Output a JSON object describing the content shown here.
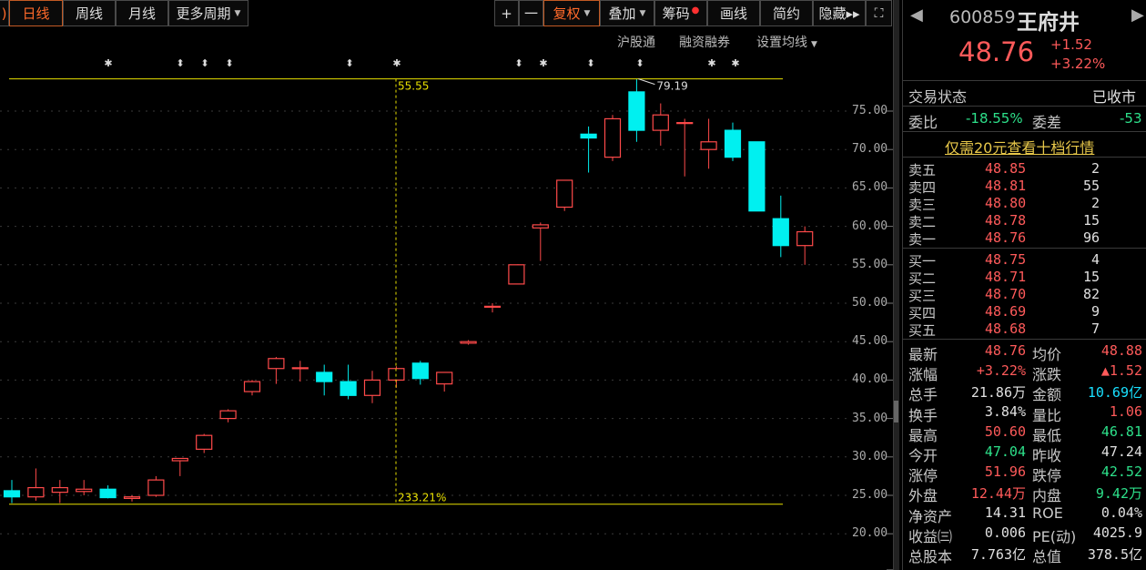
{
  "toolbar": {
    "periods": [
      "日线",
      "周线",
      "月线",
      "更多周期"
    ],
    "tools": [
      "+",
      "一",
      "复权",
      "叠加",
      "筹码",
      "画线",
      "简约",
      "隐藏▸▸"
    ]
  },
  "subbar": {
    "hgt": "沪股通",
    "margin": "融资融券",
    "ma_setting": "设置均线"
  },
  "chart_data": {
    "type": "candlestick",
    "y_ticks": [
      "75.00",
      "70.00",
      "65.00",
      "60.00",
      "55.00",
      "50.00",
      "45.00",
      "40.00",
      "35.00",
      "30.00",
      "25.00",
      "20.00"
    ],
    "ylim": [
      15,
      85
    ],
    "annotations": {
      "high_label": "79.19",
      "top_line": "55.55",
      "bottom_pct": "233.21%"
    },
    "candles": [
      {
        "o": 25.6,
        "h": 27.0,
        "l": 24.0,
        "c": 24.8
      },
      {
        "o": 24.8,
        "h": 28.5,
        "l": 24.3,
        "c": 26.0
      },
      {
        "o": 25.4,
        "h": 27.0,
        "l": 24.0,
        "c": 26.0
      },
      {
        "o": 25.5,
        "h": 27.0,
        "l": 25.0,
        "c": 25.8
      },
      {
        "o": 25.8,
        "h": 26.3,
        "l": 24.6,
        "c": 24.7
      },
      {
        "o": 24.6,
        "h": 25.0,
        "l": 24.2,
        "c": 24.8
      },
      {
        "o": 25.0,
        "h": 27.5,
        "l": 24.8,
        "c": 27.0
      },
      {
        "o": 29.5,
        "h": 29.8,
        "l": 27.5,
        "c": 29.8
      },
      {
        "o": 31.0,
        "h": 33.0,
        "l": 30.5,
        "c": 32.8
      },
      {
        "o": 35.0,
        "h": 36.2,
        "l": 34.5,
        "c": 36.0
      },
      {
        "o": 38.5,
        "h": 40.0,
        "l": 38.0,
        "c": 39.8
      },
      {
        "o": 41.5,
        "h": 43.0,
        "l": 39.5,
        "c": 42.8
      },
      {
        "o": 41.6,
        "h": 42.5,
        "l": 39.8,
        "c": 41.6
      },
      {
        "o": 41.0,
        "h": 42.0,
        "l": 38.0,
        "c": 39.8
      },
      {
        "o": 39.8,
        "h": 42.0,
        "l": 37.5,
        "c": 38.0
      },
      {
        "o": 38.0,
        "h": 41.2,
        "l": 37.0,
        "c": 40.0
      },
      {
        "o": 40.0,
        "h": 41.8,
        "l": 39.0,
        "c": 41.5
      },
      {
        "o": 42.2,
        "h": 42.5,
        "l": 39.4,
        "c": 40.2
      },
      {
        "o": 39.5,
        "h": 41.0,
        "l": 38.5,
        "c": 41.0
      },
      {
        "o": 44.8,
        "h": 45.2,
        "l": 44.6,
        "c": 45.0
      },
      {
        "o": 49.5,
        "h": 50.0,
        "l": 48.8,
        "c": 49.6
      },
      {
        "o": 52.5,
        "h": 55.0,
        "l": 52.5,
        "c": 55.0
      },
      {
        "o": 59.8,
        "h": 60.5,
        "l": 55.5,
        "c": 60.2
      },
      {
        "o": 62.5,
        "h": 66.0,
        "l": 62.0,
        "c": 66.0
      },
      {
        "o": 72.0,
        "h": 73.0,
        "l": 67.0,
        "c": 71.5
      },
      {
        "o": 69.0,
        "h": 74.5,
        "l": 68.5,
        "c": 74.0
      },
      {
        "o": 77.5,
        "h": 79.19,
        "l": 71.0,
        "c": 72.5
      },
      {
        "o": 72.5,
        "h": 76.0,
        "l": 70.5,
        "c": 74.5
      },
      {
        "o": 73.5,
        "h": 74.0,
        "l": 66.5,
        "c": 73.5
      },
      {
        "o": 70.0,
        "h": 74.0,
        "l": 67.5,
        "c": 71.0
      },
      {
        "o": 72.5,
        "h": 73.5,
        "l": 68.5,
        "c": 69.0
      },
      {
        "o": 71.0,
        "h": 71.0,
        "l": 62.0,
        "c": 62.0
      },
      {
        "o": 61.0,
        "h": 64.0,
        "l": 56.0,
        "c": 57.5
      },
      {
        "o": 57.5,
        "h": 60.0,
        "l": 55.0,
        "c": 59.3
      }
    ]
  },
  "quote": {
    "code": "600859",
    "name": "王府井",
    "price": "48.76",
    "change": "+1.52",
    "pct": "+3.22%",
    "status_label": "交易状态",
    "status": "已收市",
    "weibi_label": "委比",
    "weibi": "-18.55%",
    "weicha_label": "委差",
    "weicha": "-53",
    "promo": "仅需20元查看十档行情",
    "asks": [
      {
        "label": "卖五",
        "price": "48.85",
        "vol": "2"
      },
      {
        "label": "卖四",
        "price": "48.81",
        "vol": "55"
      },
      {
        "label": "卖三",
        "price": "48.80",
        "vol": "2"
      },
      {
        "label": "卖二",
        "price": "48.78",
        "vol": "15"
      },
      {
        "label": "卖一",
        "price": "48.76",
        "vol": "96"
      }
    ],
    "bids": [
      {
        "label": "买一",
        "price": "48.75",
        "vol": "4"
      },
      {
        "label": "买二",
        "price": "48.71",
        "vol": "15"
      },
      {
        "label": "买三",
        "price": "48.70",
        "vol": "82"
      },
      {
        "label": "买四",
        "price": "48.69",
        "vol": "9"
      },
      {
        "label": "买五",
        "price": "48.68",
        "vol": "7"
      }
    ],
    "stats": [
      {
        "l1": "最新",
        "v1": "48.76",
        "c1": "red",
        "l2": "均价",
        "v2": "48.88",
        "c2": "red"
      },
      {
        "l1": "涨幅",
        "v1": "+3.22%",
        "c1": "red",
        "l2": "涨跌",
        "v2": "▲1.52",
        "c2": "red"
      },
      {
        "l1": "总手",
        "v1": "21.86万",
        "c1": "wht",
        "l2": "金额",
        "v2": "10.69亿",
        "c2": "cyan"
      },
      {
        "l1": "换手",
        "v1": "3.84%",
        "c1": "wht",
        "l2": "量比",
        "v2": "1.06",
        "c2": "red"
      },
      {
        "l1": "最高",
        "v1": "50.60",
        "c1": "red",
        "l2": "最低",
        "v2": "46.81",
        "c2": "grn"
      },
      {
        "l1": "今开",
        "v1": "47.04",
        "c1": "grn",
        "l2": "昨收",
        "v2": "47.24",
        "c2": "wht"
      },
      {
        "l1": "涨停",
        "v1": "51.96",
        "c1": "red",
        "l2": "跌停",
        "v2": "42.52",
        "c2": "grn"
      },
      {
        "l1": "外盘",
        "v1": "12.44万",
        "c1": "red",
        "l2": "内盘",
        "v2": "9.42万",
        "c2": "grn"
      },
      {
        "l1": "净资产",
        "v1": "14.31",
        "c1": "wht",
        "l2": "ROE",
        "v2": "0.04%",
        "c2": "wht"
      },
      {
        "l1": "收益㈢",
        "v1": "0.006",
        "c1": "wht",
        "l2": "PE(动)",
        "v2": "4025.9",
        "c2": "wht"
      },
      {
        "l1": "总股本",
        "v1": "7.763亿",
        "c1": "wht",
        "l2": "总值",
        "v2": "378.5亿",
        "c2": "wht"
      }
    ]
  }
}
